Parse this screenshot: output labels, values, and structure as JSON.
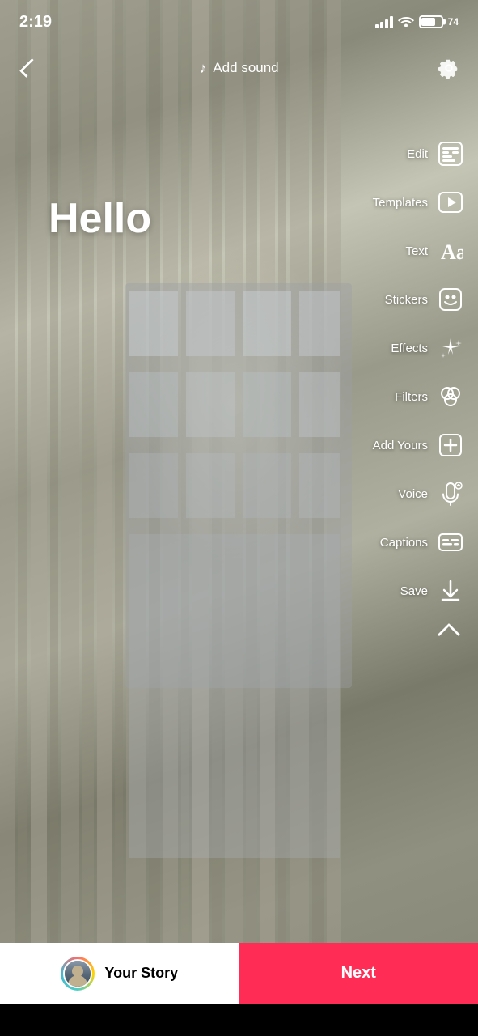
{
  "statusBar": {
    "time": "2:19",
    "battery": "74"
  },
  "header": {
    "addSound": "Add sound",
    "back": "back"
  },
  "content": {
    "helloText": "Hello"
  },
  "tools": [
    {
      "id": "edit",
      "label": "Edit",
      "icon": "edit"
    },
    {
      "id": "templates",
      "label": "Templates",
      "icon": "templates"
    },
    {
      "id": "text",
      "label": "Text",
      "icon": "text"
    },
    {
      "id": "stickers",
      "label": "Stickers",
      "icon": "stickers"
    },
    {
      "id": "effects",
      "label": "Effects",
      "icon": "effects"
    },
    {
      "id": "filters",
      "label": "Filters",
      "icon": "filters"
    },
    {
      "id": "add-yours",
      "label": "Add Yours",
      "icon": "add-yours"
    },
    {
      "id": "voice",
      "label": "Voice",
      "icon": "voice"
    },
    {
      "id": "captions",
      "label": "Captions",
      "icon": "captions"
    },
    {
      "id": "save",
      "label": "Save",
      "icon": "save"
    }
  ],
  "bottomBar": {
    "yourStory": "Your Story",
    "next": "Next"
  }
}
